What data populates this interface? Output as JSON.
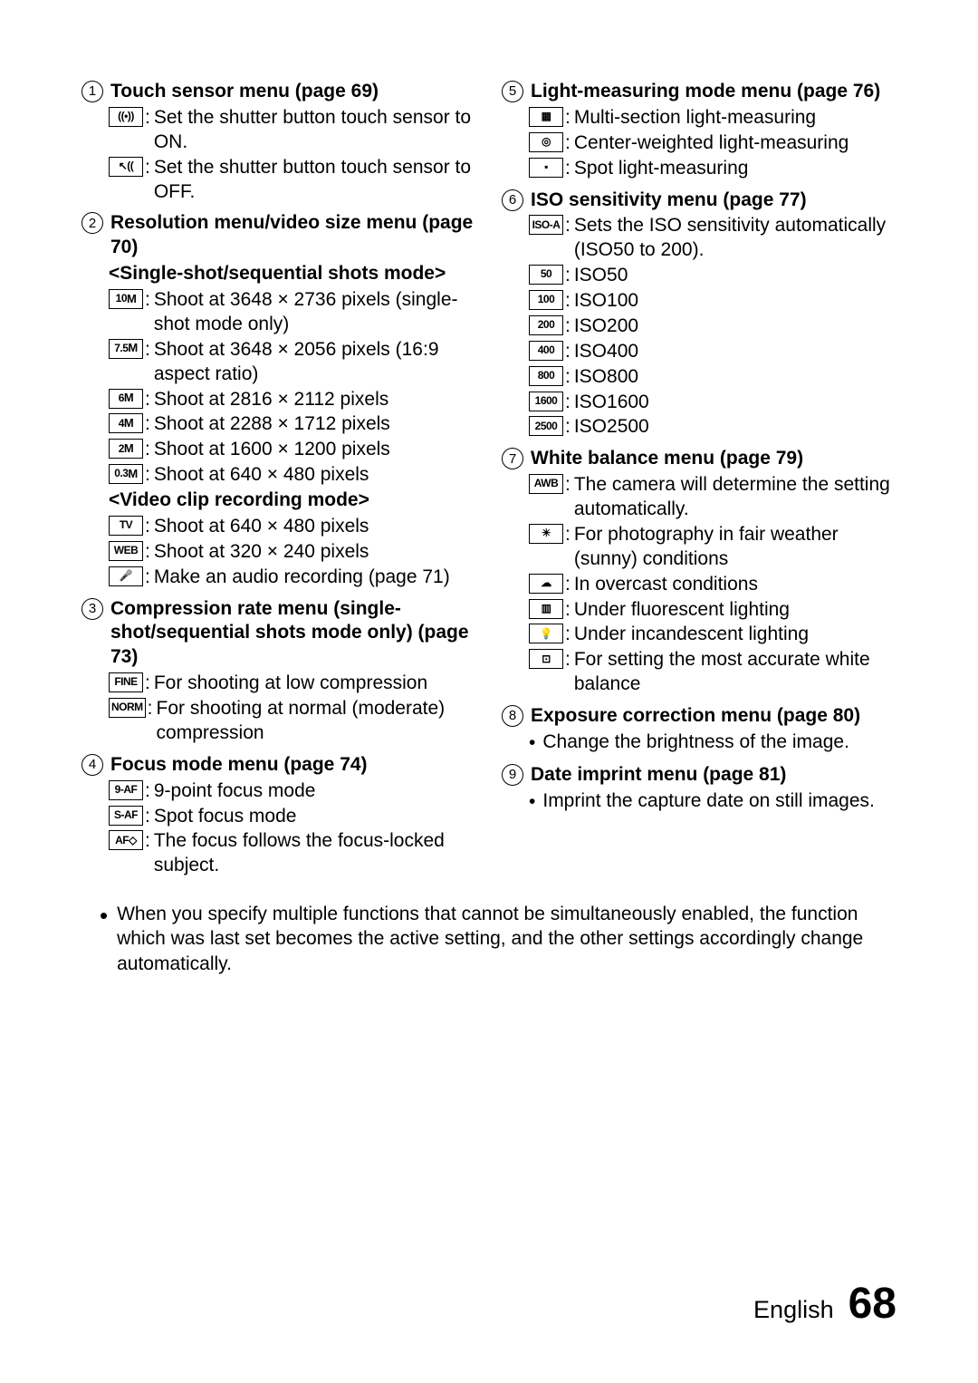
{
  "footer": {
    "lang": "English",
    "page": "68"
  },
  "footnote": "When you specify multiple functions that cannot be simultaneously enabled, the function which was last set becomes the active setting, and the other settings accordingly change automatically.",
  "left": [
    {
      "num": "1",
      "title": "Touch sensor menu (page 69)",
      "items": [
        {
          "icon": "((•))",
          "desc": "Set the shutter button touch sensor to ON."
        },
        {
          "icon": "↖((",
          "desc": "Set the shutter button touch sensor to OFF."
        }
      ]
    },
    {
      "num": "2",
      "title": "Resolution menu/video size menu (page 70)",
      "subhead1": "<Single-shot/sequential shots mode>",
      "items1": [
        {
          "icon": "10",
          "sub": "M",
          "desc": "Shoot at 3648 × 2736 pixels (single-shot mode only)"
        },
        {
          "icon": "7.5",
          "sub": "M",
          "desc": "Shoot at 3648 × 2056 pixels (16:9 aspect ratio)"
        },
        {
          "icon": "6",
          "sub": "M",
          "desc": "Shoot at 2816 × 2112 pixels"
        },
        {
          "icon": "4",
          "sub": "M",
          "desc": "Shoot at 2288 × 1712 pixels"
        },
        {
          "icon": "2",
          "sub": "M",
          "desc": "Shoot at 1600 × 1200 pixels"
        },
        {
          "icon": "0.3",
          "sub": "M",
          "desc": "Shoot at 640 × 480 pixels"
        }
      ],
      "subhead2": "<Video clip recording mode>",
      "items2": [
        {
          "icon": "TV",
          "desc": "Shoot at 640 × 480 pixels"
        },
        {
          "icon": "WEB",
          "desc": "Shoot at 320 × 240 pixels"
        },
        {
          "icon": "🎤",
          "desc": "Make an audio recording (page 71)"
        }
      ]
    },
    {
      "num": "3",
      "title": "Compression rate menu (single-shot/sequential shots mode only) (page 73)",
      "items": [
        {
          "icon": "FINE",
          "desc": "For shooting at low compression"
        },
        {
          "icon": "NORM",
          "desc": "For shooting at normal (moderate) compression"
        }
      ]
    },
    {
      "num": "4",
      "title": "Focus mode menu (page 74)",
      "items": [
        {
          "icon": "9-AF",
          "desc": "9-point focus mode"
        },
        {
          "icon": "S-AF",
          "desc": "Spot focus mode"
        },
        {
          "icon": "AF◇",
          "desc": "The focus follows the focus-locked subject."
        }
      ]
    }
  ],
  "right": [
    {
      "num": "5",
      "title": "Light-measuring mode menu (page 76)",
      "items": [
        {
          "icon": "▦",
          "desc": "Multi-section light-measuring"
        },
        {
          "icon": "◎",
          "desc": "Center-weighted light-measuring"
        },
        {
          "icon": "▪",
          "desc": "Spot light-measuring"
        }
      ]
    },
    {
      "num": "6",
      "title": "ISO sensitivity menu (page 77)",
      "items": [
        {
          "icon": "ISO-A",
          "desc": "Sets the ISO sensitivity automatically (ISO50 to 200)."
        },
        {
          "icon": "50",
          "desc": "ISO50"
        },
        {
          "icon": "100",
          "desc": "ISO100"
        },
        {
          "icon": "200",
          "desc": "ISO200"
        },
        {
          "icon": "400",
          "desc": "ISO400"
        },
        {
          "icon": "800",
          "desc": "ISO800"
        },
        {
          "icon": "1600",
          "desc": "ISO1600"
        },
        {
          "icon": "2500",
          "desc": "ISO2500"
        }
      ]
    },
    {
      "num": "7",
      "title": "White balance menu (page 79)",
      "items": [
        {
          "icon": "AWB",
          "desc": "The camera will determine the setting automatically."
        },
        {
          "icon": "☀",
          "desc": "For photography in fair weather (sunny) conditions"
        },
        {
          "icon": "☁",
          "desc": "In overcast conditions"
        },
        {
          "icon": "▥",
          "desc": "Under fluorescent lighting"
        },
        {
          "icon": "💡",
          "desc": "Under incandescent lighting"
        },
        {
          "icon": "⊡",
          "desc": "For setting the most accurate white balance"
        }
      ]
    },
    {
      "num": "8",
      "title": "Exposure correction menu (page 80)",
      "bullets": [
        "Change the brightness of the image."
      ]
    },
    {
      "num": "9",
      "title": "Date imprint menu (page 81)",
      "bullets": [
        "Imprint the capture date on still images."
      ]
    }
  ]
}
